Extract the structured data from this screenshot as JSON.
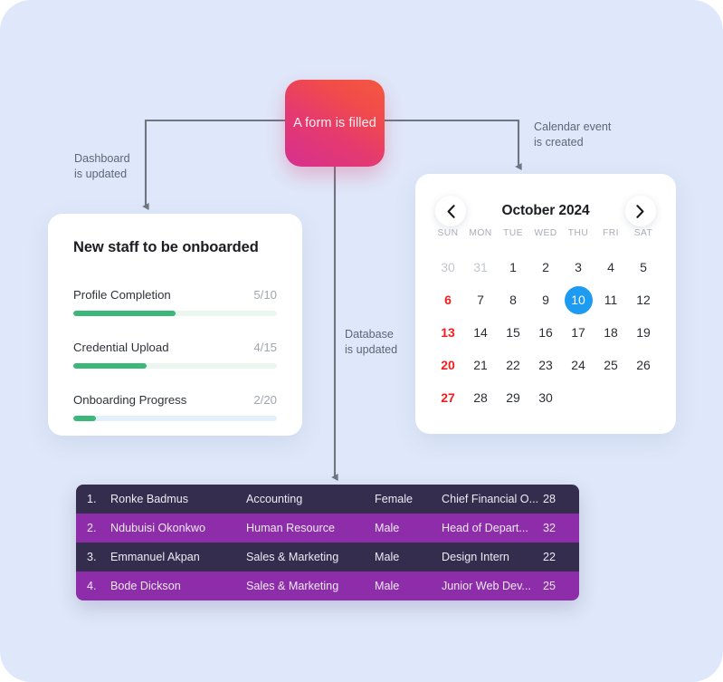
{
  "canvas": {
    "background_color": "#dfe8fa"
  },
  "trigger_node": {
    "label": "A form\nis filled",
    "gradient_from": "#d6308f",
    "gradient_to": "#f4583f"
  },
  "edges": [
    {
      "id": "dashboard",
      "label": "Dashboard\nis updated"
    },
    {
      "id": "calendar",
      "label": "Calendar event\nis created"
    },
    {
      "id": "database",
      "label": "Database\nis updated"
    }
  ],
  "dashboard_card": {
    "title": "New staff to be onboarded",
    "accent_color": "#3cb77a",
    "metrics": [
      {
        "label": "Profile Completion",
        "value": "5/10",
        "percent": 50,
        "track": "green"
      },
      {
        "label": "Credential Upload",
        "value": "4/15",
        "percent": 36,
        "track": "green"
      },
      {
        "label": "Onboarding Progress",
        "value": "2/20",
        "percent": 11,
        "track": "blue"
      }
    ]
  },
  "calendar_card": {
    "month_label": "October 2024",
    "prev_icon": "chevron-left-icon",
    "next_icon": "chevron-right-icon",
    "weekdays": [
      "SUN",
      "MON",
      "TUE",
      "WED",
      "THU",
      "FRI",
      "SAT"
    ],
    "selected_day": 10,
    "selected_color": "#1d9bf0",
    "sunday_color": "#f51c1c",
    "days": [
      {
        "n": "30",
        "state": "muted"
      },
      {
        "n": "31",
        "state": "muted"
      },
      {
        "n": "1",
        "state": "normal"
      },
      {
        "n": "2",
        "state": "normal"
      },
      {
        "n": "3",
        "state": "normal"
      },
      {
        "n": "4",
        "state": "normal"
      },
      {
        "n": "5",
        "state": "normal"
      },
      {
        "n": "6",
        "state": "sunday"
      },
      {
        "n": "7",
        "state": "normal"
      },
      {
        "n": "8",
        "state": "normal"
      },
      {
        "n": "9",
        "state": "normal"
      },
      {
        "n": "10",
        "state": "selected"
      },
      {
        "n": "11",
        "state": "normal"
      },
      {
        "n": "12",
        "state": "normal"
      },
      {
        "n": "13",
        "state": "sunday"
      },
      {
        "n": "14",
        "state": "normal"
      },
      {
        "n": "15",
        "state": "normal"
      },
      {
        "n": "16",
        "state": "normal"
      },
      {
        "n": "17",
        "state": "normal"
      },
      {
        "n": "18",
        "state": "normal"
      },
      {
        "n": "19",
        "state": "normal"
      },
      {
        "n": "20",
        "state": "sunday"
      },
      {
        "n": "21",
        "state": "normal"
      },
      {
        "n": "22",
        "state": "normal"
      },
      {
        "n": "23",
        "state": "normal"
      },
      {
        "n": "24",
        "state": "normal"
      },
      {
        "n": "25",
        "state": "normal"
      },
      {
        "n": "26",
        "state": "normal"
      },
      {
        "n": "27",
        "state": "sunday"
      },
      {
        "n": "28",
        "state": "normal"
      },
      {
        "n": "29",
        "state": "normal"
      },
      {
        "n": "30",
        "state": "normal"
      },
      {
        "n": "",
        "state": "empty"
      },
      {
        "n": "",
        "state": "empty"
      },
      {
        "n": "",
        "state": "empty"
      }
    ]
  },
  "staff_table": {
    "row_color_odd": "#342d4e",
    "row_color_even": "#8e2daa",
    "rows": [
      {
        "index": "1.",
        "name": "Ronke Badmus",
        "department": "Accounting",
        "gender": "Female",
        "role": "Chief Financial O...",
        "age": "28"
      },
      {
        "index": "2.",
        "name": "Ndubuisi Okonkwo",
        "department": "Human Resource",
        "gender": "Male",
        "role": "Head of Depart...",
        "age": "32"
      },
      {
        "index": "3.",
        "name": "Emmanuel Akpan",
        "department": "Sales & Marketing",
        "gender": "Male",
        "role": "Design Intern",
        "age": "22"
      },
      {
        "index": "4.",
        "name": "Bode Dickson",
        "department": "Sales & Marketing",
        "gender": "Male",
        "role": "Junior Web Dev...",
        "age": "25"
      }
    ]
  }
}
